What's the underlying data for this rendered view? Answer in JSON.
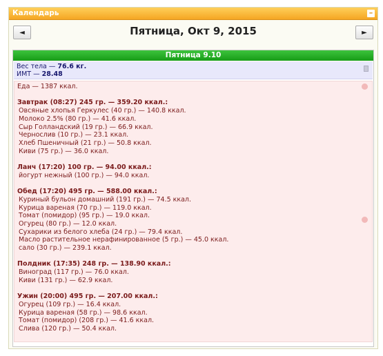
{
  "widget": {
    "title": "Календарь",
    "collapse_symbol": "–"
  },
  "nav": {
    "prev_symbol": "◄",
    "next_symbol": "►",
    "date_title": "Пятница, Окт 9, 2015"
  },
  "day": {
    "header": "Пятница 9.10",
    "weight_label": "Вес тела — ",
    "weight_value": "76.6 кг.",
    "bmi_label": "ИМТ — ",
    "bmi_value": "28.48",
    "food_total": "Еда — 1387 ккал.",
    "meals": [
      {
        "title": "Завтрак (08:27) 245 гр. — 359.20 ккал.:",
        "items": [
          "Овсяные хлопья Геркулес (40 гр.) — 140.8 ккал.",
          "Молоко 2.5% (80 гр.) — 41.6 ккал.",
          "Сыр Голландский (19 гр.) — 66.9 ккал.",
          "Чернослив (10 гр.) — 23.1 ккал.",
          "Хлеб Пшеничный (21 гр.) — 50.8 ккал.",
          "Киви (75 гр.) — 36.0 ккал."
        ]
      },
      {
        "title": "Ланч (17:20) 100 гр. — 94.00 ккал.:",
        "items": [
          "йогурт нежный (100 гр.) — 94.0 ккал."
        ]
      },
      {
        "title": "Обед (17:20) 495 гр. — 588.00 ккал.:",
        "items": [
          "Куриный бульон домашний (191 гр.) — 74.5 ккал.",
          "Курица вареная (70 гр.) — 119.0 ккал.",
          "Томат (помидор) (95 гр.) — 19.0 ккал.",
          "Огурец (80 гр.) — 12.0 ккал.",
          "Сухарики из белого хлеба (24 гр.) — 79.4 ккал.",
          "Масло растительное нерафинированное (5 гр.) — 45.0 ккал.",
          "сало (30 гр.) — 239.1 ккал."
        ]
      },
      {
        "title": "Полдник (17:35) 248 гр. — 138.90 ккал.:",
        "items": [
          "Виноград (117 гр.) — 76.0 ккал.",
          "Киви (131 гр.) — 62.9 ккал."
        ]
      },
      {
        "title": "Ужин (20:00) 495 гр. — 207.00 ккал.:",
        "items": [
          "Огурец (109 гр.) — 16.4 ккал.",
          "Курица вареная (58 гр.) — 98.6 ккал.",
          "Томат (помидор) (208 гр.) — 41.6 ккал.",
          "Слива (120 гр.) — 50.4 ккал."
        ]
      }
    ]
  }
}
